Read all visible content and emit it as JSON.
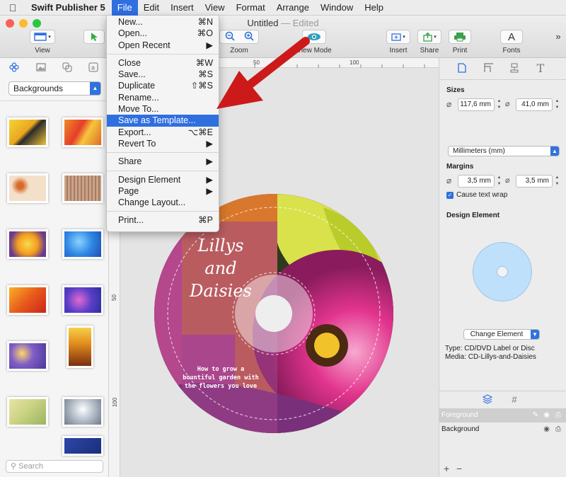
{
  "menubar": {
    "app_name": "Swift Publisher 5",
    "menus": [
      "File",
      "Edit",
      "Insert",
      "View",
      "Format",
      "Arrange",
      "Window",
      "Help"
    ]
  },
  "window": {
    "title": "Untitled",
    "status": "— Edited"
  },
  "toolbar": {
    "view": "View",
    "zoom": "Zoom",
    "view_mode": "View Mode",
    "insert": "Insert",
    "share": "Share",
    "print": "Print",
    "fonts": "Fonts",
    "more": "»"
  },
  "sidebar": {
    "category": "Backgrounds",
    "search_placeholder": "Search"
  },
  "file_menu": {
    "groups": [
      [
        {
          "label": "New...",
          "shortcut": "⌘N"
        },
        {
          "label": "Open...",
          "shortcut": "⌘O"
        },
        {
          "label": "Open Recent",
          "shortcut": "▶"
        }
      ],
      [
        {
          "label": "Close",
          "shortcut": "⌘W"
        },
        {
          "label": "Save...",
          "shortcut": "⌘S"
        },
        {
          "label": "Duplicate",
          "shortcut": "⇧⌘S"
        },
        {
          "label": "Rename...",
          "shortcut": ""
        },
        {
          "label": "Move To...",
          "shortcut": ""
        },
        {
          "label": "Save as Template...",
          "shortcut": ""
        },
        {
          "label": "Export...",
          "shortcut": "⌥⌘E"
        },
        {
          "label": "Revert To",
          "shortcut": "▶"
        }
      ],
      [
        {
          "label": "Share",
          "shortcut": "▶"
        }
      ],
      [
        {
          "label": "Design Element",
          "shortcut": "▶"
        },
        {
          "label": "Page",
          "shortcut": "▶"
        },
        {
          "label": "Change Layout...",
          "shortcut": ""
        }
      ],
      [
        {
          "label": "Print...",
          "shortcut": "⌘P"
        }
      ]
    ],
    "highlighted": "Save as Template..."
  },
  "canvas": {
    "ruler_h": [
      "50",
      "100"
    ],
    "ruler_v": [
      "50",
      "100"
    ],
    "disc": {
      "title_lines": [
        "Lillys",
        "and",
        "Daisies"
      ],
      "subtitle_lines": [
        "How to grow a",
        "bountiful garden with",
        "the flowers you love"
      ]
    }
  },
  "inspector": {
    "sizes_title": "Sizes",
    "width": "117,6 mm",
    "height": "41,0 mm",
    "units": "Millimeters (mm)",
    "margins_title": "Margins",
    "margin_h": "3,5 mm",
    "margin_v": "3,5 mm",
    "cause_text_wrap": "Cause text wrap",
    "design_element_title": "Design Element",
    "change_element": "Change Element",
    "type_line": "Type: CD/DVD Label or Disc",
    "media_line": "Media: CD-Lillys-and-Daisies",
    "layers": [
      "Foreground",
      "Background"
    ],
    "add": "+",
    "remove": "−"
  },
  "colors": {
    "accent": "#2f6fe0",
    "arrow": "#cc1a1a",
    "close": "#fc5f57",
    "minimize": "#fdbc2e",
    "zoom": "#28c840"
  }
}
